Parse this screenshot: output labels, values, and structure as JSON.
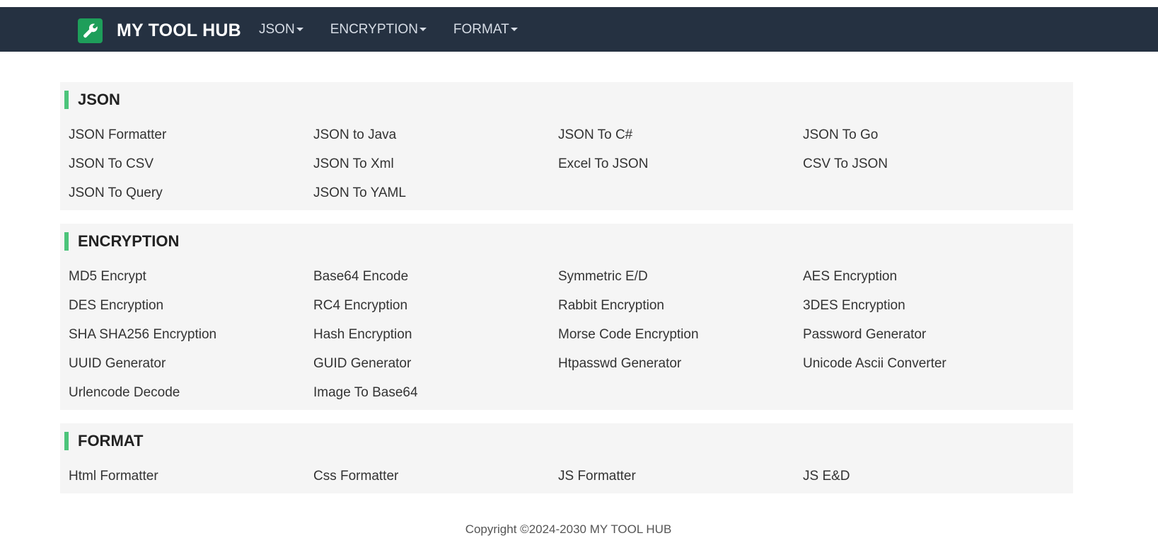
{
  "header": {
    "brand_name": "MY TOOL HUB",
    "logo_icon": "wrench-icon",
    "logo_color": "#1e9e5a",
    "background": "#253141",
    "nav": [
      {
        "label": "JSON"
      },
      {
        "label": "ENCRYPTION"
      },
      {
        "label": "FORMAT"
      }
    ]
  },
  "sections": [
    {
      "title": "JSON",
      "tools": [
        "JSON Formatter",
        "JSON to Java",
        "JSON To C#",
        "JSON To Go",
        "JSON To CSV",
        "JSON To Xml",
        "Excel To JSON",
        "CSV To JSON",
        "JSON To Query",
        "JSON To YAML"
      ]
    },
    {
      "title": "ENCRYPTION",
      "tools": [
        "MD5 Encrypt",
        "Base64 Encode",
        "Symmetric E/D",
        "AES Encryption",
        "DES Encryption",
        "RC4 Encryption",
        "Rabbit Encryption",
        "3DES Encryption",
        "SHA SHA256 Encryption",
        "Hash Encryption",
        "Morse Code Encryption",
        "Password Generator",
        "UUID Generator",
        "GUID Generator",
        "Htpasswd Generator",
        "Unicode Ascii Converter",
        "Urlencode Decode",
        "Image To Base64"
      ]
    },
    {
      "title": "FORMAT",
      "tools": [
        "Html Formatter",
        "Css Formatter",
        "JS Formatter",
        "JS E&D"
      ]
    }
  ],
  "accent_color": "#4cc47a",
  "footer": {
    "copyright": "Copyright ©2024-2030 MY TOOL HUB"
  }
}
